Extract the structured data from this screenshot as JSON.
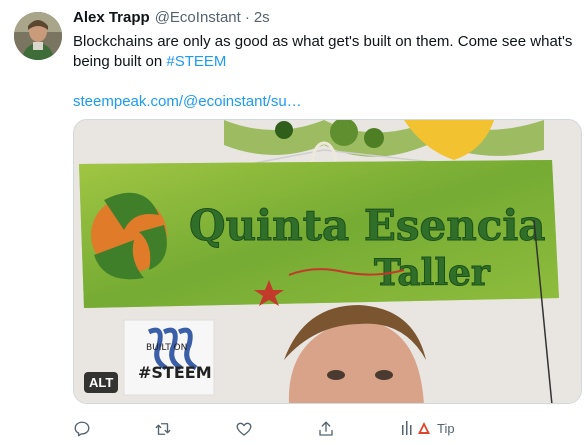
{
  "tweet": {
    "author_name": "Alex Trapp",
    "author_handle": "@EcoInstant",
    "separator": "·",
    "timestamp": "2s",
    "text_main": "Blockchains are only as good as what get's built on them.  Come see what's being built on ",
    "hashtag": "#STEEM",
    "link": "steempeak.com/@ecoinstant/su…",
    "media": {
      "alt_badge": "ALT",
      "sign_text_line1": "Quinta Esencia",
      "sign_text_line2": "Taller",
      "sticker_line1": "BUILT ON",
      "sticker_line2": "#STEEM"
    },
    "actions": {
      "reply_icon": "reply-bubble-icon",
      "retweet_icon": "retweet-icon",
      "like_icon": "heart-icon",
      "share_icon": "share-icon",
      "tip_label": "Tip"
    }
  },
  "colors": {
    "hashtag_link": "#1d9bf0",
    "secondary_text": "#536471",
    "sign_green": "#7fb43a",
    "sign_orange": "#e07b2a"
  }
}
